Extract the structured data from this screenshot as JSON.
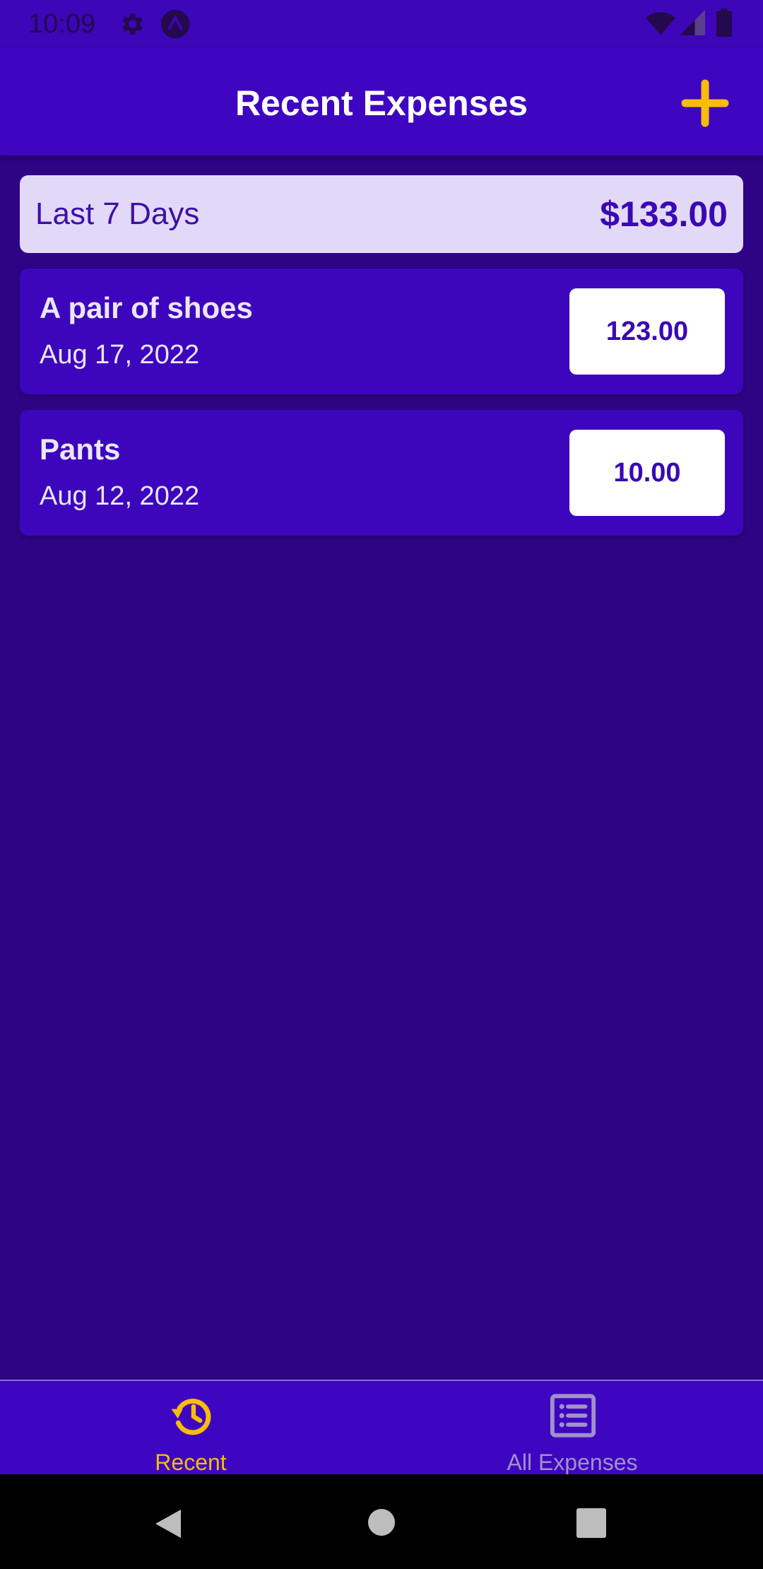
{
  "status_bar": {
    "time": "10:09",
    "icons": [
      "gear-icon",
      "expo-icon",
      "wifi-icon",
      "signal-icon",
      "battery-icon"
    ]
  },
  "header": {
    "title": "Recent Expenses",
    "add_icon": "plus-icon"
  },
  "summary": {
    "period": "Last 7 Days",
    "total": "$133.00"
  },
  "expenses": [
    {
      "description": "A pair of shoes",
      "date": "Aug 17, 2022",
      "amount": "123.00"
    },
    {
      "description": "Pants",
      "date": "Aug 12, 2022",
      "amount": "10.00"
    }
  ],
  "tabs": [
    {
      "label": "Recent",
      "icon": "history-icon",
      "active": true
    },
    {
      "label": "All Expenses",
      "icon": "list-icon",
      "active": false
    }
  ],
  "system_nav": [
    "back-icon",
    "home-icon",
    "recents-icon"
  ],
  "colors": {
    "primary": "#3e06c0",
    "background": "#2e0485",
    "accent": "#f7bc0c",
    "summary_bg": "#e2d9f8",
    "inactive_tab": "#a191c9"
  }
}
